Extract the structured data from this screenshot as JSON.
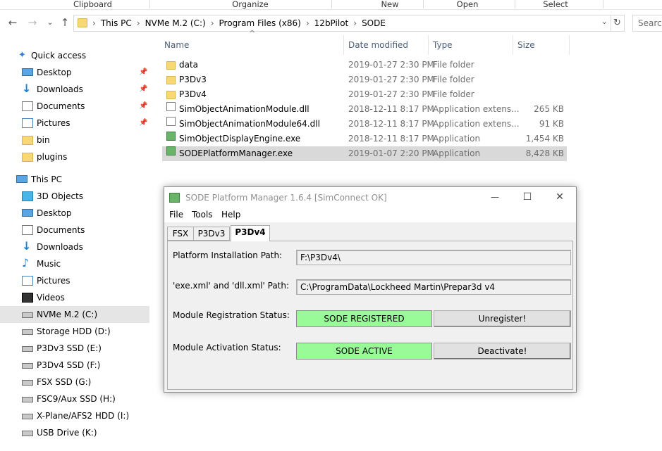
{
  "ribbon": {
    "groups": [
      "Clipboard",
      "Organize",
      "New",
      "Open",
      "Select"
    ]
  },
  "nav": {
    "back": "←",
    "forward": "→",
    "recent": "⌄",
    "up": "↑"
  },
  "address": {
    "crumbs": [
      "This PC",
      "NVMe M.2 (C:)",
      "Program Files (x86)",
      "12bPilot",
      "SODE"
    ],
    "dropdown": "⌄",
    "refresh": "↻",
    "search_placeholder": "Search"
  },
  "sidebar": {
    "quick_access": "Quick access",
    "quick_items": [
      {
        "label": "Desktop",
        "icon": "desktop-icon",
        "pinned": true
      },
      {
        "label": "Downloads",
        "icon": "downloads-icon",
        "pinned": true
      },
      {
        "label": "Documents",
        "icon": "documents-icon",
        "pinned": true
      },
      {
        "label": "Pictures",
        "icon": "pictures-icon",
        "pinned": true
      },
      {
        "label": "bin",
        "icon": "folder-icon",
        "pinned": false
      },
      {
        "label": "plugins",
        "icon": "folder-icon",
        "pinned": false
      }
    ],
    "this_pc": "This PC",
    "pc_items": [
      {
        "label": "3D Objects",
        "icon": "3d-objects-icon"
      },
      {
        "label": "Desktop",
        "icon": "desktop-icon"
      },
      {
        "label": "Documents",
        "icon": "documents-icon"
      },
      {
        "label": "Downloads",
        "icon": "downloads-icon"
      },
      {
        "label": "Music",
        "icon": "music-icon"
      },
      {
        "label": "Pictures",
        "icon": "pictures-icon"
      },
      {
        "label": "Videos",
        "icon": "videos-icon"
      },
      {
        "label": "NVMe M.2 (C:)",
        "icon": "drive-icon"
      },
      {
        "label": "Storage HDD (D:)",
        "icon": "drive-icon"
      },
      {
        "label": "P3Dv3 SSD (E:)",
        "icon": "drive-icon"
      },
      {
        "label": "P3Dv4 SSD (F:)",
        "icon": "drive-icon"
      },
      {
        "label": "FSX SSD (G:)",
        "icon": "drive-icon"
      },
      {
        "label": "FSC9/Aux SSD (H:)",
        "icon": "drive-icon"
      },
      {
        "label": "X-Plane/AFS2 HDD (I:)",
        "icon": "drive-icon"
      },
      {
        "label": "USB Drive (K:)",
        "icon": "usb-drive-icon"
      }
    ],
    "pin_glyph": "📌"
  },
  "columns": {
    "name": "Name",
    "date": "Date modified",
    "type": "Type",
    "size": "Size",
    "sort_glyph": "^"
  },
  "files": [
    {
      "name": "data",
      "date": "2019-01-27 2:30 PM",
      "type": "File folder",
      "size": "",
      "kind": "folder"
    },
    {
      "name": "P3Dv3",
      "date": "2019-01-27 2:30 PM",
      "type": "File folder",
      "size": "",
      "kind": "folder"
    },
    {
      "name": "P3Dv4",
      "date": "2019-01-27 2:30 PM",
      "type": "File folder",
      "size": "",
      "kind": "folder"
    },
    {
      "name": "SimObjectAnimationModule.dll",
      "date": "2018-12-11 8:17 PM",
      "type": "Application extens...",
      "size": "265 KB",
      "kind": "dll"
    },
    {
      "name": "SimObjectAnimationModule64.dll",
      "date": "2018-12-11 8:17 PM",
      "type": "Application extens...",
      "size": "91 KB",
      "kind": "dll"
    },
    {
      "name": "SimObjectDisplayEngine.exe",
      "date": "2018-12-11 8:17 PM",
      "type": "Application",
      "size": "1,454 KB",
      "kind": "exe"
    },
    {
      "name": "SODEPlatformManager.exe",
      "date": "2019-01-07 2:20 PM",
      "type": "Application",
      "size": "8,428 KB",
      "kind": "exe"
    }
  ],
  "dialog": {
    "title": "SODE Platform Manager 1.6.4 [SimConnect OK]",
    "minimize": "—",
    "maximize": "☐",
    "close": "✕",
    "menu": [
      "File",
      "Tools",
      "Help"
    ],
    "tabs": [
      "FSX",
      "P3Dv3",
      "P3Dv4"
    ],
    "active_tab": "P3Dv4",
    "install_path_label": "Platform Installation Path:",
    "install_path_value": "F:\\P3Dv4\\",
    "xml_path_label": "'exe.xml' and 'dll.xml' Path:",
    "xml_path_value": "C:\\ProgramData\\Lockheed Martin\\Prepar3d v4",
    "reg_status_label": "Module Registration Status:",
    "reg_status_value": "SODE REGISTERED",
    "unregister_button": "Unregister!",
    "act_status_label": "Module Activation Status:",
    "act_status_value": "SODE ACTIVE",
    "deactivate_button": "Deactivate!",
    "status_color": "#98fb98"
  }
}
